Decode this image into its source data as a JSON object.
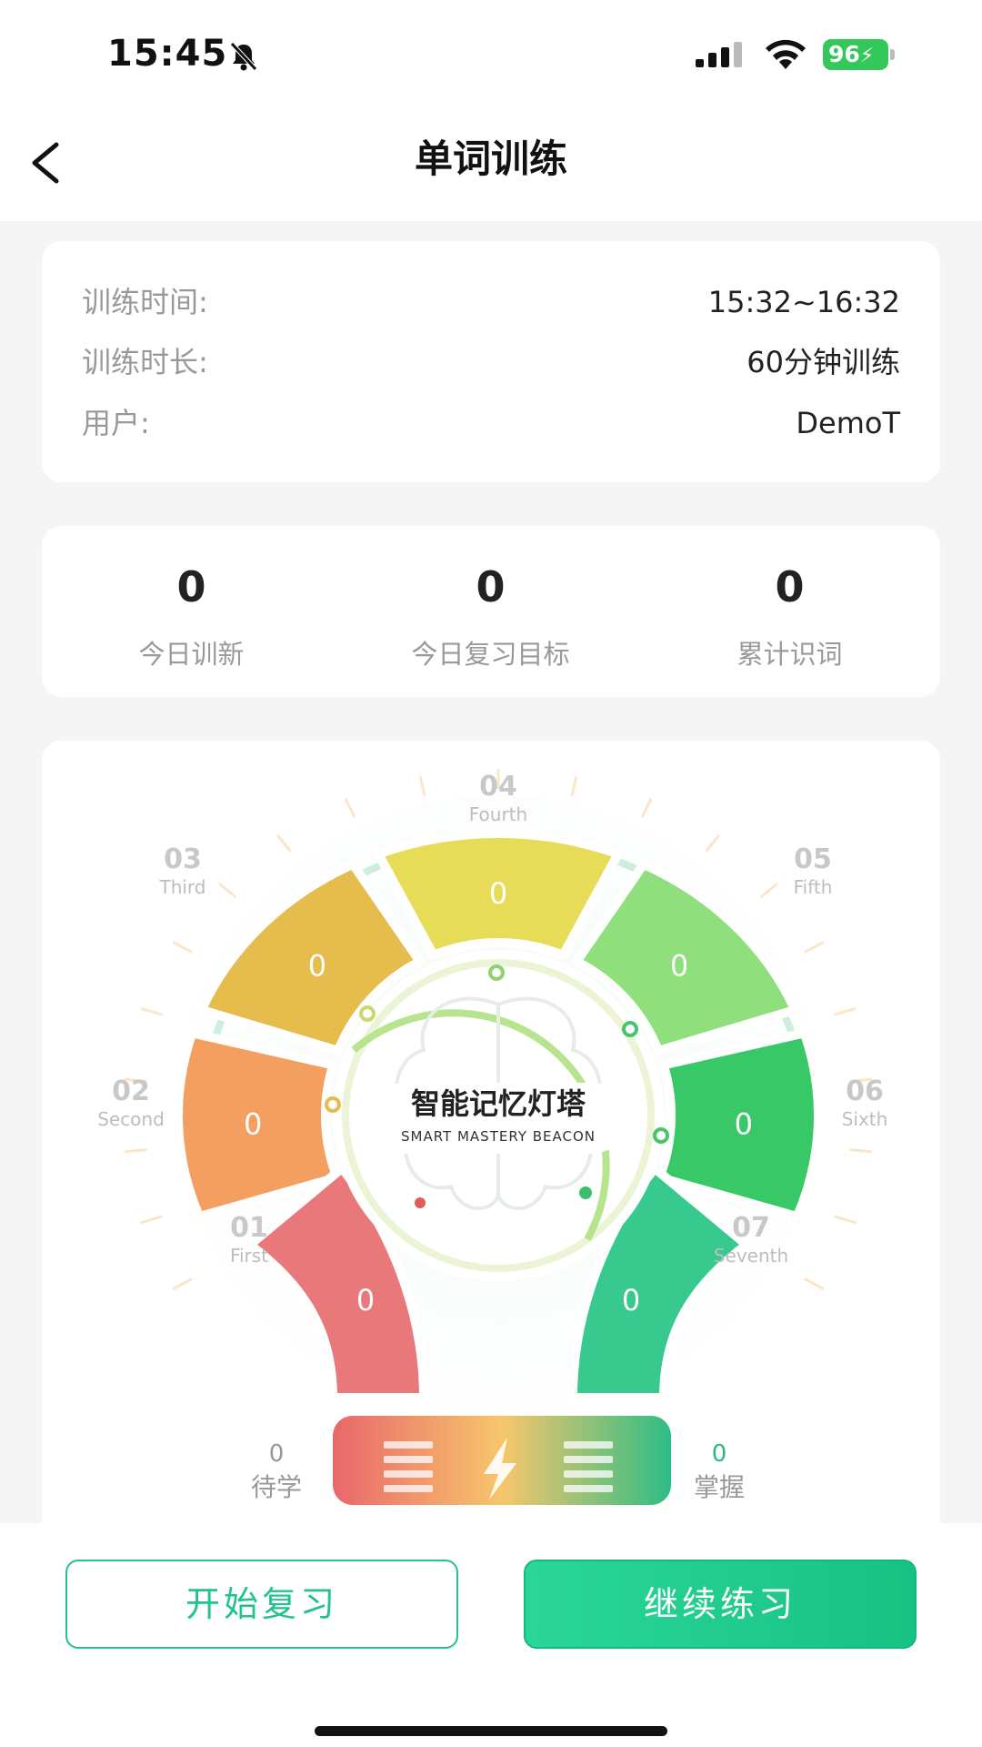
{
  "status_bar": {
    "time": "15:45",
    "battery": "96"
  },
  "nav": {
    "title": "单词训练"
  },
  "info": [
    {
      "label": "训练时间:",
      "value": "15:32~16:32"
    },
    {
      "label": "训练时长:",
      "value": "60分钟训练"
    },
    {
      "label": "用户:",
      "value": "DemoT"
    }
  ],
  "stats": [
    {
      "value": "0",
      "label": "今日训新"
    },
    {
      "value": "0",
      "label": "今日复习目标"
    },
    {
      "value": "0",
      "label": "累计识词"
    }
  ],
  "beacon": {
    "title": "智能记忆灯塔",
    "subtitle": "SMART MASTERY BEACON",
    "stages": [
      {
        "num": "01",
        "name": "First",
        "value": "0",
        "color": "#e9787a"
      },
      {
        "num": "02",
        "name": "Second",
        "value": "0",
        "color": "#f39f5f"
      },
      {
        "num": "03",
        "name": "Third",
        "value": "0",
        "color": "#e6bc4d"
      },
      {
        "num": "04",
        "name": "Fourth",
        "value": "0",
        "color": "#e7dc58"
      },
      {
        "num": "05",
        "name": "Fifth",
        "value": "0",
        "color": "#8fe07d"
      },
      {
        "num": "06",
        "name": "Sixth",
        "value": "0",
        "color": "#38c867"
      },
      {
        "num": "07",
        "name": "Seventh",
        "value": "0",
        "color": "#37c98e"
      }
    ],
    "pending": {
      "value": "0",
      "label": "待学"
    },
    "mastered": {
      "value": "0",
      "label": "掌握"
    }
  },
  "actions": {
    "review": "开始复习",
    "continue": "继续练习"
  }
}
